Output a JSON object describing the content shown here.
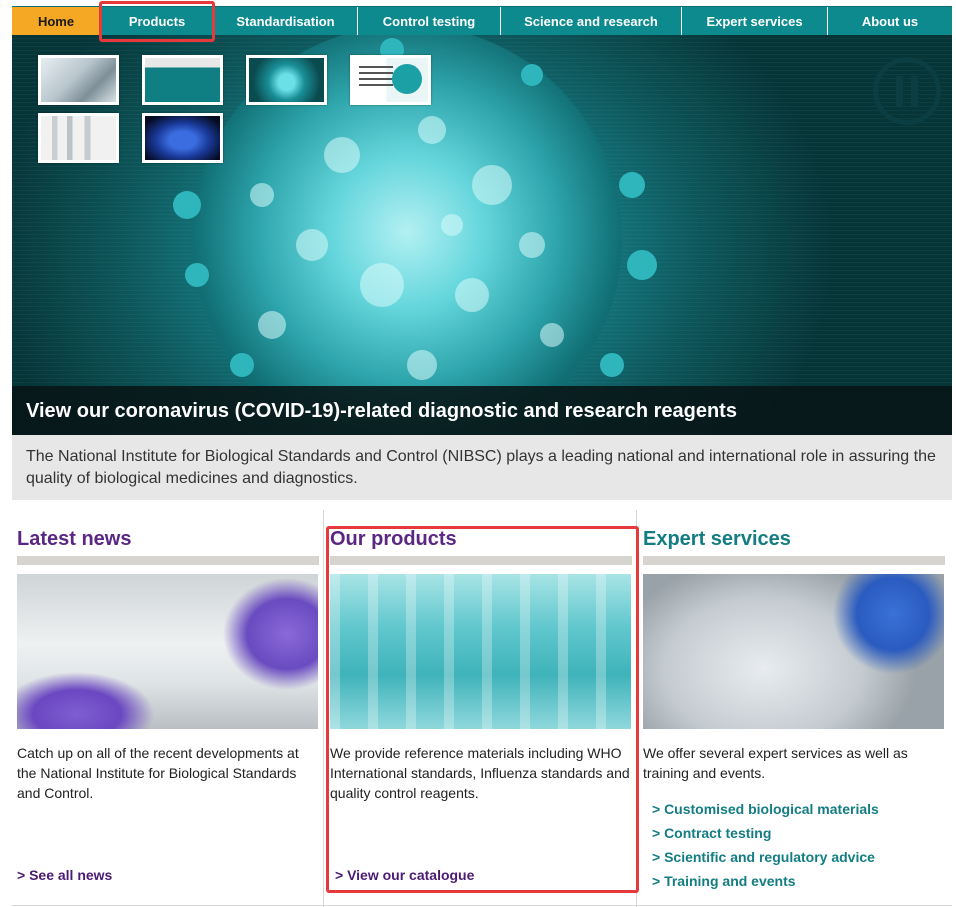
{
  "nav": {
    "items": [
      {
        "label": "Home",
        "active": true
      },
      {
        "label": "Products"
      },
      {
        "label": "Standardisation"
      },
      {
        "label": "Control testing"
      },
      {
        "label": "Science and research"
      },
      {
        "label": "Expert services"
      },
      {
        "label": "About us"
      }
    ]
  },
  "hero": {
    "caption": "View our coronavirus (COVID-19)-related diagnostic and research reagents",
    "thumbnails": 6,
    "pause_icon": "pause-icon"
  },
  "intro": {
    "text": "The National Institute for Biological Standards and Control (NIBSC) plays a leading national and international role in assuring the quality of biological medicines and diagnostics."
  },
  "columns": {
    "news": {
      "title": "Latest news",
      "text": "Catch up on all of the recent developments at the National Institute for Biological Standards and Control.",
      "link": "> See all news"
    },
    "products": {
      "title": "Our products",
      "text": "We provide reference materials including WHO International standards, Influenza standards and quality control reagents.",
      "link": "> View our catalogue"
    },
    "services": {
      "title": "Expert services",
      "text": "We offer several expert services as well as training and events.",
      "links": [
        "> Customised biological materials",
        "> Contract testing",
        "> Scientific and regulatory advice",
        "> Training and events"
      ]
    }
  },
  "colors": {
    "nav_teal": "#0c8a8e",
    "home_orange": "#f5a823",
    "purple": "#5b2784",
    "teal_text": "#137d82",
    "highlight_red": "#e5393b"
  }
}
